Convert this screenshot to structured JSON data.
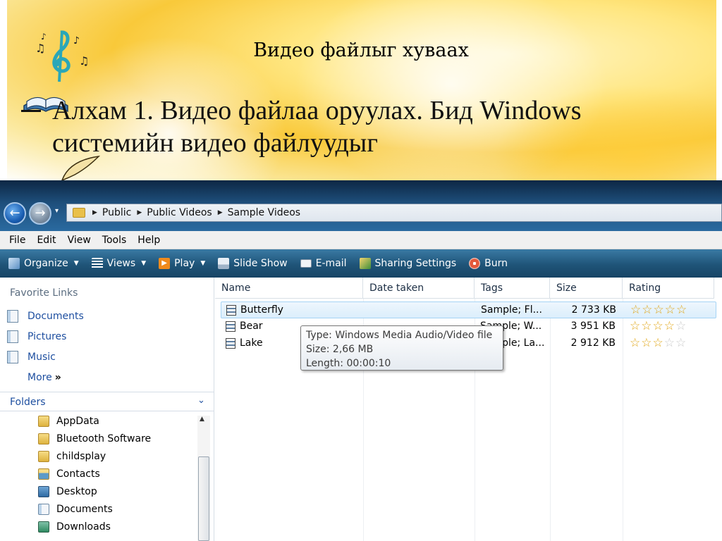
{
  "slide": {
    "title": "Видео файлыг хуваах",
    "body": "Алхам 1.  Видео файлаа оруулах. Бид Windows системийн видео файлуудыг"
  },
  "explorer": {
    "breadcrumb": [
      "Public",
      "Public Videos",
      "Sample Videos"
    ],
    "menu": [
      "File",
      "Edit",
      "View",
      "Tools",
      "Help"
    ],
    "toolbar": [
      {
        "label": "Organize",
        "icon": "organize-icon",
        "dropdown": true
      },
      {
        "label": "Views",
        "icon": "views-icon",
        "dropdown": true
      },
      {
        "label": "Play",
        "icon": "play-icon",
        "dropdown": true
      },
      {
        "label": "Slide Show",
        "icon": "slideshow-icon",
        "dropdown": false
      },
      {
        "label": "E-mail",
        "icon": "email-icon",
        "dropdown": false
      },
      {
        "label": "Sharing Settings",
        "icon": "sharing-icon",
        "dropdown": false
      },
      {
        "label": "Burn",
        "icon": "burn-icon",
        "dropdown": false
      }
    ],
    "nav": {
      "favorites_heading": "Favorite Links",
      "favorites": [
        "Documents",
        "Pictures",
        "Music"
      ],
      "more": "More",
      "more_glyph": "»",
      "folders_heading": "Folders",
      "tree": [
        "AppData",
        "Bluetooth Software",
        "childsplay",
        "Contacts",
        "Desktop",
        "Documents",
        "Downloads"
      ]
    },
    "columns": [
      "Name",
      "Date taken",
      "Tags",
      "Size",
      "Rating"
    ],
    "files": [
      {
        "name": "Butterfly",
        "date": "",
        "tags": "Sample; Fl...",
        "size": "2 733 KB",
        "rating": 5,
        "selected": true
      },
      {
        "name": "Bear",
        "date": "",
        "tags": "Sample; W...",
        "size": "3 951 KB",
        "rating": 4,
        "selected": false
      },
      {
        "name": "Lake",
        "date": "",
        "tags": "Sample; La...",
        "size": "2 912 KB",
        "rating": 3,
        "selected": false
      }
    ],
    "tooltip": {
      "type": "Type: Windows Media Audio/Video file",
      "size": "Size: 2,66 MB",
      "length": "Length: 00:00:10"
    },
    "colors": {
      "link": "#1e4fa0",
      "star": "#e0a411",
      "toolbar": "#1f5478"
    }
  }
}
